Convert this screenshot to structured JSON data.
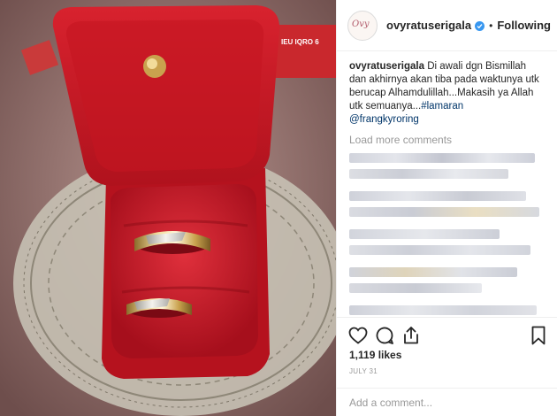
{
  "post": {
    "username": "ovyratuserigala",
    "follow_status": "Following",
    "separator": "•",
    "verified_icon": "verified-badge-icon",
    "accent": "#3897f0",
    "caption_prefix": "Di awali dgn Bismillah dan akhirnya akan tiba pada waktunya utk berucap Alhamdulillah...Makasih ya Allah utk semuanya...",
    "caption_hashtag": "#lamaran",
    "caption_mention": "@frangkyroring",
    "load_more": "Load more comments",
    "likes": "1,119 likes",
    "date": "JULY 31",
    "add_comment_placeholder": "Add a comment..."
  },
  "photo": {
    "box_label": "IEU IQRO 6"
  },
  "icons": {
    "like": "heart-icon",
    "comment": "comment-icon",
    "share": "share-icon",
    "save": "bookmark-icon"
  }
}
